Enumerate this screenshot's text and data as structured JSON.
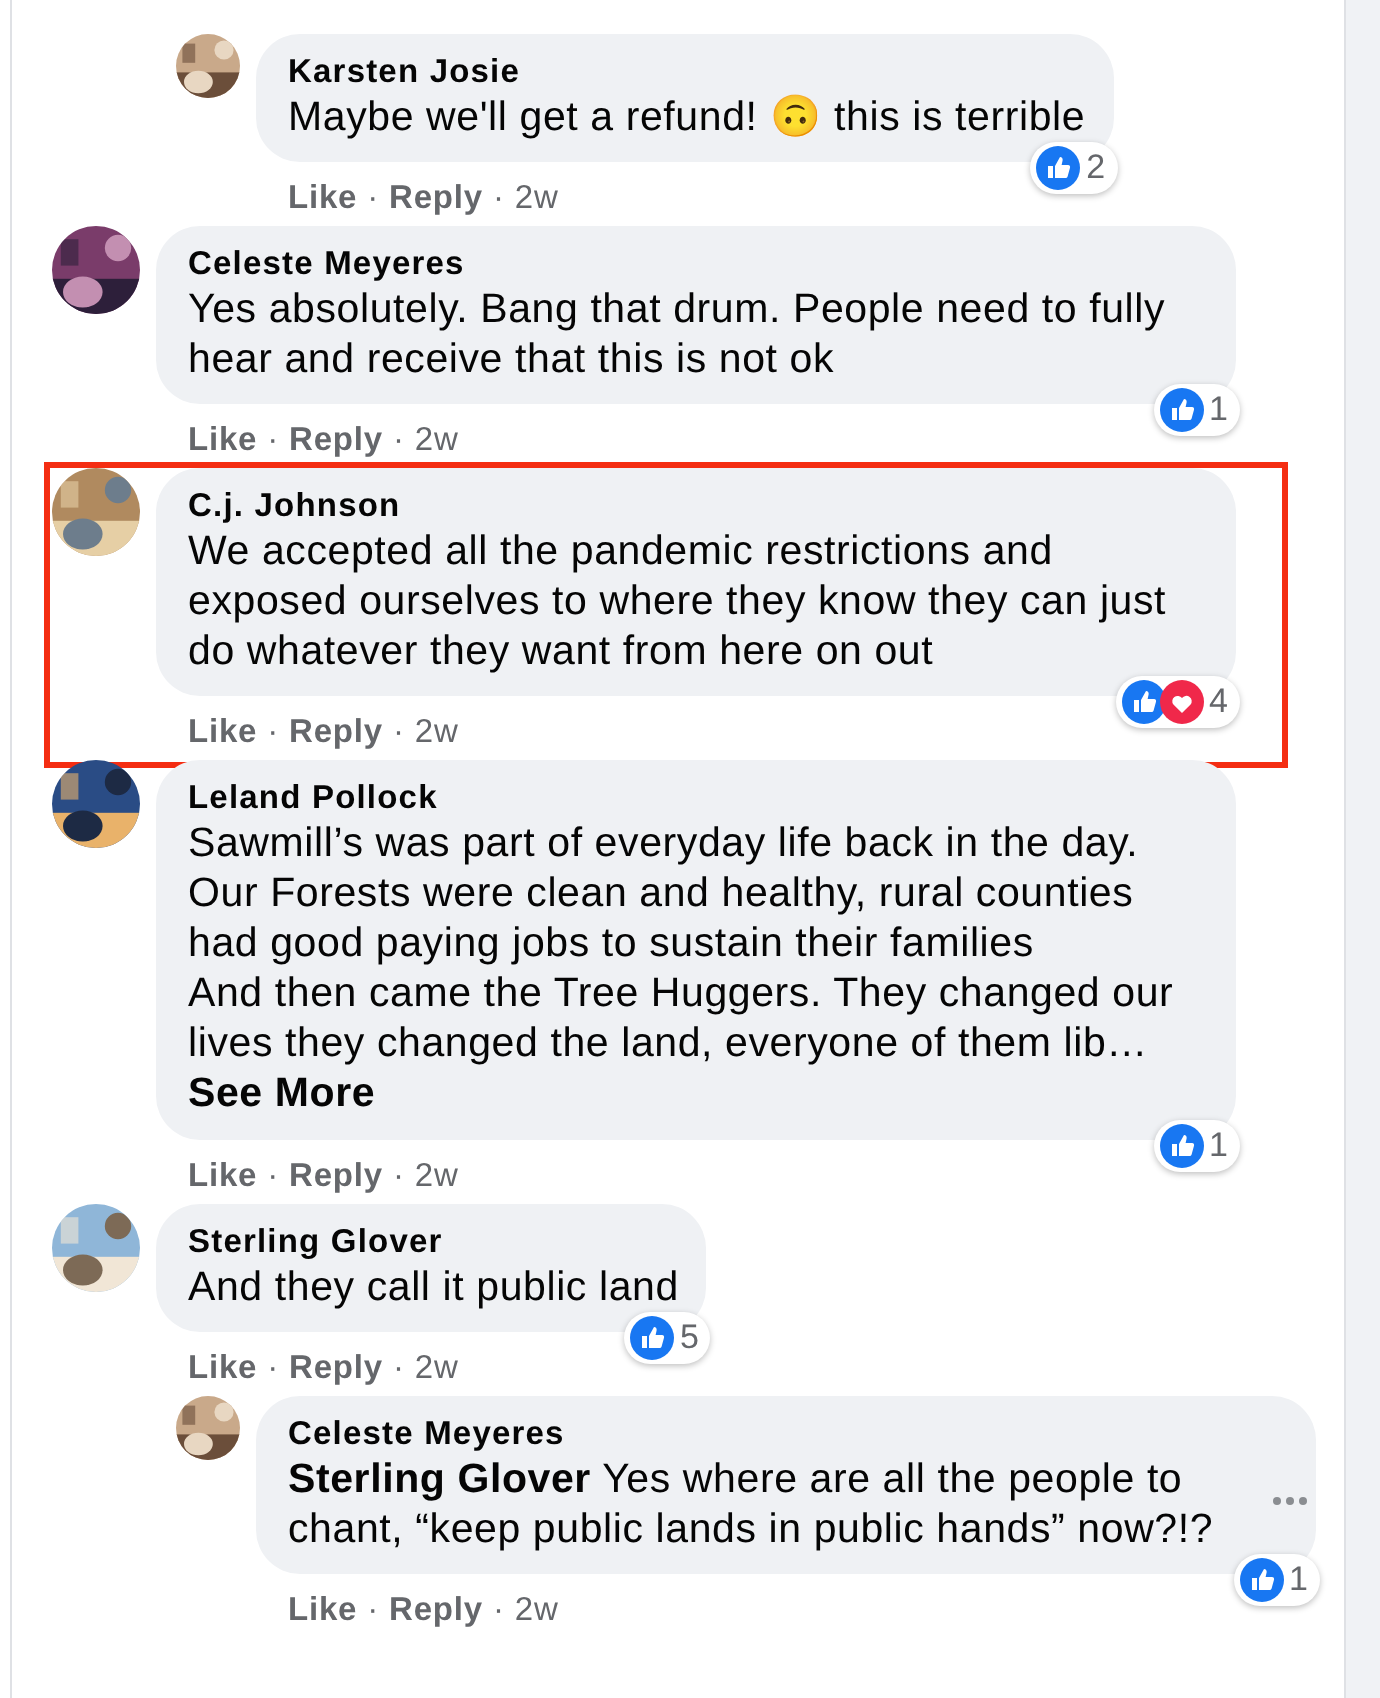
{
  "comments": [
    {
      "kind": "reply",
      "name": "Karsten Josie",
      "text": "Maybe we'll get a refund! 🙃 this is terrible",
      "reactions": {
        "like": true,
        "count": "2"
      },
      "actions": [
        "Like",
        "Reply"
      ],
      "separator": "·",
      "time": "2w",
      "highlighted": false,
      "more_menu": false
    },
    {
      "kind": "comment",
      "name": "Celeste Meyeres",
      "text": "Yes absolutely. Bang that drum. People need to fully hear and receive that this is not ok",
      "reactions": {
        "like": true,
        "count": "1"
      },
      "actions": [
        "Like",
        "Reply"
      ],
      "separator": "·",
      "time": "2w",
      "highlighted": false,
      "more_menu": false
    },
    {
      "kind": "comment",
      "name": "C.j. Johnson",
      "text": "We accepted all the pandemic restrictions and exposed ourselves to where they know they can just do whatever they want from here on out",
      "reactions": {
        "like": true,
        "love": true,
        "count": "4"
      },
      "actions": [
        "Like",
        "Reply"
      ],
      "separator": "·",
      "time": "2w",
      "highlighted": true,
      "more_menu": false
    },
    {
      "kind": "comment",
      "name": "Leland Pollock",
      "text": "Sawmill’s was part of everyday life back in the day. Our Forests were clean and healthy, rural counties had good paying jobs to sustain their families\nAnd then came the Tree Huggers. They changed our lives they changed the land, everyone of them lib…",
      "see_more": "See More",
      "reactions": {
        "like": true,
        "count": "1"
      },
      "actions": [
        "Like",
        "Reply"
      ],
      "separator": "·",
      "time": "2w",
      "highlighted": false,
      "more_menu": false
    },
    {
      "kind": "comment",
      "name": "Sterling Glover",
      "text": "And they call it public land",
      "reactions": {
        "like": true,
        "count": "5"
      },
      "actions": [
        "Like",
        "Reply"
      ],
      "separator": "·",
      "time": "2w",
      "highlighted": false,
      "more_menu": false,
      "children": [
        {
          "kind": "reply",
          "name": "Celeste Meyeres",
          "text": "**Sterling Glover** Yes where are all the people to chant, “keep public lands in public hands” now?!?",
          "reactions": {
            "like": true,
            "count": "1"
          },
          "actions": [
            "Like",
            "Reply"
          ],
          "separator": "·",
          "time": "2w",
          "highlighted": false,
          "more_menu": true
        }
      ]
    }
  ]
}
